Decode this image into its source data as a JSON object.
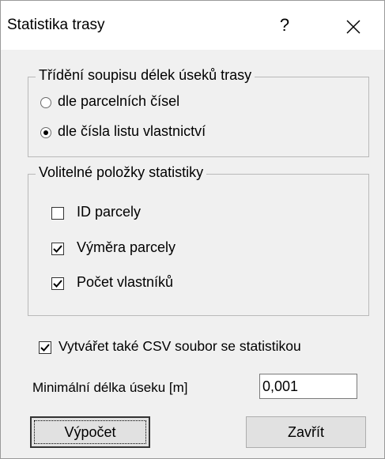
{
  "window": {
    "title": "Statistika trasy",
    "help_label": "?"
  },
  "sort_group": {
    "title": "Třídění soupisu délek úseků trasy",
    "options": [
      {
        "label": "dle parcelních čísel",
        "selected": false
      },
      {
        "label": "dle čísla listu vlastnictví",
        "selected": true
      }
    ]
  },
  "optional_group": {
    "title": "Volitelné položky statistiky",
    "items": [
      {
        "label": "ID parcely",
        "checked": false
      },
      {
        "label": "Výměra parcely",
        "checked": true
      },
      {
        "label": "Počet vlastníků",
        "checked": true
      }
    ]
  },
  "csv_option": {
    "label": "Vytvářet také CSV soubor se statistikou",
    "checked": true
  },
  "min_length": {
    "label": "Minimální délka úseku [m]",
    "value": "0,001"
  },
  "buttons": {
    "compute": "Výpočet",
    "close": "Zavřít"
  }
}
